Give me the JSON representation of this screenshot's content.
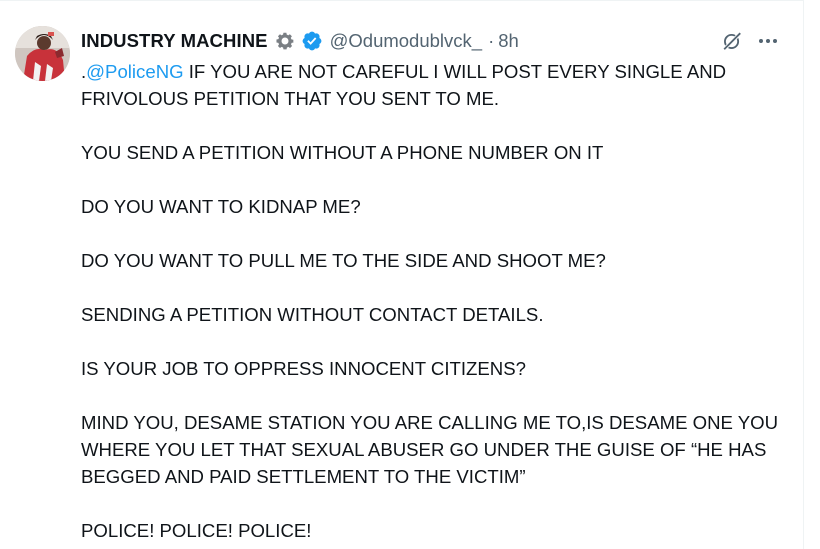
{
  "author": {
    "name": "INDUSTRY MACHINE",
    "handle": "@Odumodublvck_",
    "separator": "·",
    "time": "8h",
    "badge_icons": [
      "gear-icon",
      "verified-badge-icon"
    ],
    "verified_color": "#1d9bf0"
  },
  "actions": {
    "grok_icon": "grok-icon",
    "more_icon": "more-icon"
  },
  "tweet": {
    "prefix": ".",
    "mention": "@PoliceNG",
    "line1_rest": " IF YOU ARE NOT CAREFUL I WILL POST EVERY SINGLE AND FRIVOLOUS PETITION THAT  YOU SENT TO ME.",
    "p2": "YOU SEND A PETITION WITHOUT A PHONE NUMBER ON IT",
    "p3": "DO YOU WANT TO KIDNAP ME?",
    "p4": "DO YOU WANT TO PULL ME TO THE SIDE AND SHOOT ME?",
    "p5": "SENDING A PETITION WITHOUT CONTACT DETAILS.",
    "p6": "IS YOUR JOB TO OPPRESS INNOCENT CITIZENS?",
    "p7": "MIND YOU, DESAME STATION YOU ARE CALLING ME TO,IS DESAME  ONE YOU WHERE YOU LET THAT SEXUAL ABUSER GO UNDER THE GUISE OF “HE HAS BEGGED AND PAID SETTLEMENT TO THE VICTIM”",
    "p8": "POLICE! POLICE! POLICE!"
  },
  "colors": {
    "text": "#0f1419",
    "secondary": "#536471",
    "link": "#1d9bf0"
  }
}
